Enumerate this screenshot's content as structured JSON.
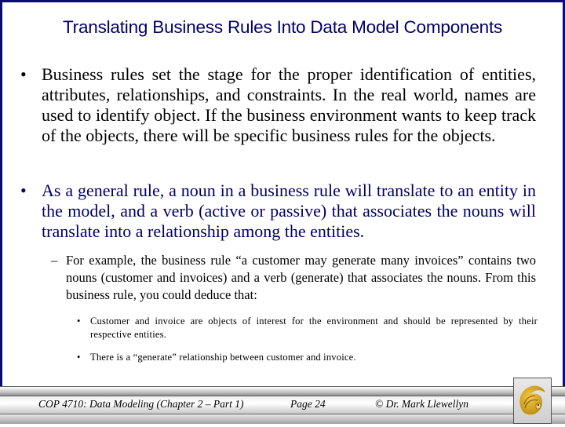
{
  "slide": {
    "title": "Translating Business Rules Into Data Model Components",
    "bullets": [
      {
        "marker": "•",
        "text": "Business rules set the stage for the proper identification of entities, attributes, relationships, and constraints.  In the real world, names are used to identify object.  If the business environment wants to keep track of the objects, there will be specific business rules for the objects."
      },
      {
        "marker": "•",
        "text": "As a general rule, a noun in a business rule will translate to an entity in the model, and a verb (active or passive) that associates the nouns will translate into a relationship among the entities.",
        "sub": {
          "marker": "–",
          "text": "For example, the business rule “a customer may generate many invoices” contains two nouns (customer and invoices) and a verb (generate) that associates the nouns.  From this business rule, you could deduce that:",
          "items": [
            {
              "marker": "•",
              "text": "Customer and invoice are objects of interest for the environment and should be represented by their respective entities."
            },
            {
              "marker": "•",
              "text": "There is a “generate” relationship between customer and invoice."
            }
          ]
        }
      }
    ]
  },
  "footer": {
    "course": "COP 4710: Data Modeling (Chapter 2 – Part 1)",
    "page": "Page 24",
    "author": "© Dr. Mark Llewellyn",
    "logo_icon": "pegasus-logo-icon"
  },
  "colors": {
    "frame": "#0a0a7a",
    "title": "#000066",
    "second_bullet": "#000066",
    "logo_gold": "#d4a017"
  }
}
